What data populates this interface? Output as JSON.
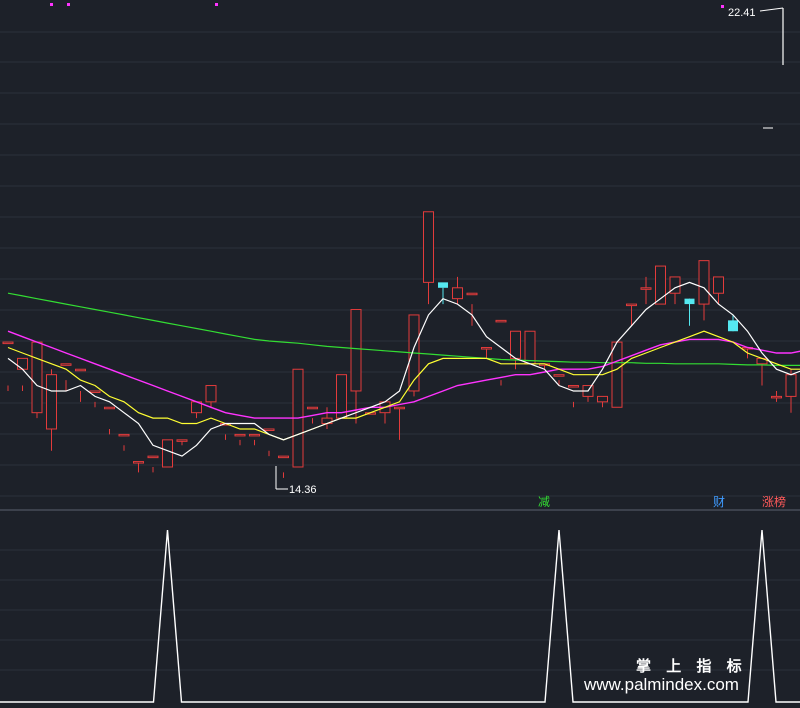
{
  "colors": {
    "background": "#1d2129",
    "grid": "#2c313b",
    "separator": "#5b6170",
    "up": "#e23b3b",
    "down": "#55e8f0",
    "ma_short": "#ffffff",
    "ma_mid": "#ffff33",
    "ma_long": "#ff33ff",
    "ma_longest": "#33dd33",
    "signal": "#ffffff",
    "marker": "#ff33ff",
    "tag_reduce": "#33dd33",
    "tag_finance": "#3f9bff",
    "tag_limit_list": "#ff5a5a"
  },
  "chart_data": [
    {
      "type": "candlestick",
      "ylim": [
        13.3,
        22.6
      ],
      "ohlc": [
        [
          16.3,
          16.3,
          15.5,
          15.4
        ],
        [
          15.8,
          16.0,
          15.5,
          15.4
        ],
        [
          15.0,
          16.3,
          16.3,
          14.9
        ],
        [
          14.7,
          15.7,
          15.8,
          14.3
        ],
        [
          15.9,
          15.9,
          15.6,
          15.4
        ],
        [
          15.8,
          15.8,
          15.4,
          15.2
        ],
        [
          15.4,
          15.4,
          15.2,
          15.1
        ],
        [
          15.1,
          15.1,
          14.7,
          14.6
        ],
        [
          14.6,
          14.6,
          14.4,
          14.3
        ],
        [
          14.1,
          14.1,
          14.1,
          13.9
        ],
        [
          14.2,
          14.2,
          14.0,
          13.9
        ],
        [
          14.0,
          14.5,
          14.5,
          14.0
        ],
        [
          14.5,
          14.5,
          14.5,
          14.4
        ],
        [
          15.0,
          15.2,
          15.2,
          14.9
        ],
        [
          15.2,
          15.5,
          15.5,
          15.1
        ],
        [
          14.8,
          14.8,
          14.6,
          14.5
        ],
        [
          14.6,
          14.6,
          14.5,
          14.4
        ],
        [
          14.6,
          14.6,
          14.5,
          14.4
        ],
        [
          14.7,
          14.7,
          14.3,
          14.2
        ],
        [
          14.2,
          14.2,
          13.9,
          13.8
        ],
        [
          14.0,
          15.8,
          15.8,
          14.0
        ],
        [
          15.1,
          15.1,
          14.9,
          14.8
        ],
        [
          14.8,
          14.9,
          15.1,
          14.7
        ],
        [
          14.9,
          15.7,
          15.7,
          14.9
        ],
        [
          15.4,
          16.9,
          15.4,
          14.8
        ],
        [
          15.0,
          15.0,
          14.9,
          14.9
        ],
        [
          15.0,
          15.2,
          15.2,
          14.8
        ],
        [
          15.1,
          15.1,
          15.1,
          14.5
        ],
        [
          15.4,
          16.8,
          16.8,
          15.3
        ],
        [
          17.4,
          18.7,
          17.4,
          17.0
        ],
        [
          17.4,
          17.3,
          17.3,
          17.0
        ],
        [
          17.1,
          17.3,
          17.5,
          17.0
        ],
        [
          17.2,
          17.2,
          17.0,
          16.6
        ],
        [
          16.2,
          16.2,
          16.2,
          16.0
        ],
        [
          16.7,
          16.7,
          15.6,
          15.5
        ],
        [
          16.0,
          16.5,
          16.0,
          15.8
        ],
        [
          15.9,
          16.5,
          16.1,
          15.9
        ],
        [
          15.9,
          15.9,
          15.9,
          15.8
        ],
        [
          15.7,
          15.7,
          15.6,
          15.5
        ],
        [
          15.5,
          15.5,
          15.2,
          15.1
        ],
        [
          15.3,
          15.5,
          15.5,
          15.2
        ],
        [
          15.2,
          15.3,
          15.3,
          15.1
        ],
        [
          15.1,
          16.3,
          16.3,
          15.1
        ],
        [
          17.0,
          17.0,
          17.0,
          16.6
        ],
        [
          17.3,
          17.3,
          17.5,
          17.0
        ],
        [
          17.0,
          17.7,
          17.3,
          17.0
        ],
        [
          17.2,
          17.5,
          17.3,
          17.0
        ],
        [
          17.1,
          17.0,
          17.1,
          16.6
        ],
        [
          17.0,
          17.8,
          17.4,
          16.7
        ],
        [
          17.2,
          17.5,
          17.5,
          17.0
        ],
        [
          16.7,
          16.5,
          16.8,
          16.5
        ],
        [
          16.2,
          16.2,
          16.2,
          16.0
        ],
        [
          15.9,
          16.0,
          15.9,
          15.5
        ],
        [
          15.3,
          15.3,
          15.4,
          15.2
        ],
        [
          15.3,
          15.7,
          15.8,
          15.0
        ],
        [
          15.2,
          15.5,
          15.5,
          14.9
        ],
        [
          15.3,
          16.2,
          16.2,
          15.3
        ],
        [
          16.4,
          18.1,
          16.4,
          16.2
        ]
      ],
      "ma_short": [
        16.0,
        15.8,
        15.5,
        15.4,
        15.4,
        15.5,
        15.3,
        15.2,
        15.0,
        14.8,
        14.4,
        14.3,
        14.2,
        14.4,
        14.7,
        14.8,
        14.8,
        14.8,
        14.6,
        14.5,
        14.6,
        14.7,
        14.8,
        14.9,
        15.0,
        15.1,
        15.2,
        15.4,
        16.2,
        16.8,
        17.1,
        17.0,
        16.8,
        16.4,
        16.2,
        16.0,
        15.9,
        15.8,
        15.5,
        15.4,
        15.4,
        15.8,
        16.3,
        16.6,
        16.9,
        17.1,
        17.3,
        17.4,
        17.3,
        17.0,
        16.8,
        16.5,
        16.1,
        15.8,
        15.7,
        15.8,
        16.5,
        17.4
      ],
      "ma_mid": [
        16.2,
        16.1,
        16.0,
        15.9,
        15.8,
        15.6,
        15.5,
        15.3,
        15.2,
        15.0,
        14.9,
        14.9,
        14.8,
        14.8,
        14.9,
        14.8,
        14.7,
        14.7,
        14.6,
        14.5,
        14.6,
        14.7,
        14.8,
        14.9,
        14.9,
        15.0,
        15.1,
        15.2,
        15.6,
        15.9,
        16.0,
        16.0,
        16.0,
        16.0,
        15.9,
        15.9,
        15.9,
        15.9,
        15.8,
        15.7,
        15.7,
        15.7,
        15.8,
        16.0,
        16.1,
        16.2,
        16.3,
        16.4,
        16.5,
        16.4,
        16.3,
        16.1,
        16.0,
        15.9,
        15.8,
        15.8,
        16.0,
        16.7
      ],
      "ma_long": [
        16.5,
        16.4,
        16.3,
        16.2,
        16.1,
        16.0,
        15.9,
        15.8,
        15.7,
        15.6,
        15.5,
        15.4,
        15.3,
        15.2,
        15.1,
        15.0,
        14.95,
        14.9,
        14.9,
        14.9,
        14.9,
        14.95,
        15.0,
        15.0,
        15.05,
        15.1,
        15.1,
        15.15,
        15.2,
        15.3,
        15.4,
        15.5,
        15.55,
        15.6,
        15.65,
        15.7,
        15.7,
        15.75,
        15.8,
        15.8,
        15.8,
        15.85,
        15.95,
        16.05,
        16.15,
        16.25,
        16.3,
        16.35,
        16.35,
        16.35,
        16.3,
        16.2,
        16.15,
        16.1,
        16.1,
        16.15,
        16.3,
        16.6
      ],
      "ma_longest": [
        17.2,
        17.15,
        17.1,
        17.05,
        17.0,
        16.95,
        16.9,
        16.85,
        16.8,
        16.75,
        16.7,
        16.65,
        16.6,
        16.55,
        16.5,
        16.45,
        16.4,
        16.35,
        16.32,
        16.3,
        16.28,
        16.25,
        16.22,
        16.2,
        16.18,
        16.16,
        16.14,
        16.12,
        16.1,
        16.08,
        16.06,
        16.04,
        16.02,
        16.0,
        15.98,
        15.97,
        15.96,
        15.95,
        15.94,
        15.93,
        15.93,
        15.92,
        15.92,
        15.92,
        15.91,
        15.91,
        15.9,
        15.9,
        15.9,
        15.9,
        15.89,
        15.88,
        15.88,
        15.87,
        15.87,
        15.87,
        15.89,
        15.95
      ],
      "annotations": {
        "max_label": "22.41",
        "min_label": "14.36",
        "tag_reduce": "减",
        "tag_finance": "财",
        "tag_limit_list": "涨榜"
      }
    },
    {
      "type": "line",
      "ylim": [
        0,
        1
      ],
      "values": [
        0,
        0,
        0,
        0,
        0,
        0,
        0,
        0,
        0,
        0,
        0,
        1,
        0,
        0,
        0,
        0,
        0,
        0,
        0,
        0,
        0,
        0,
        0,
        0,
        0,
        0,
        0,
        0,
        0,
        0,
        0,
        0,
        0,
        0,
        0,
        0,
        0,
        0,
        1,
        0,
        0,
        0,
        0,
        0,
        0,
        0,
        0,
        0,
        0,
        0,
        0,
        0,
        1,
        0,
        0,
        0,
        0,
        0
      ]
    }
  ],
  "brand": {
    "line1": "掌 上 指 标",
    "line2": "www.palmindex.com"
  }
}
